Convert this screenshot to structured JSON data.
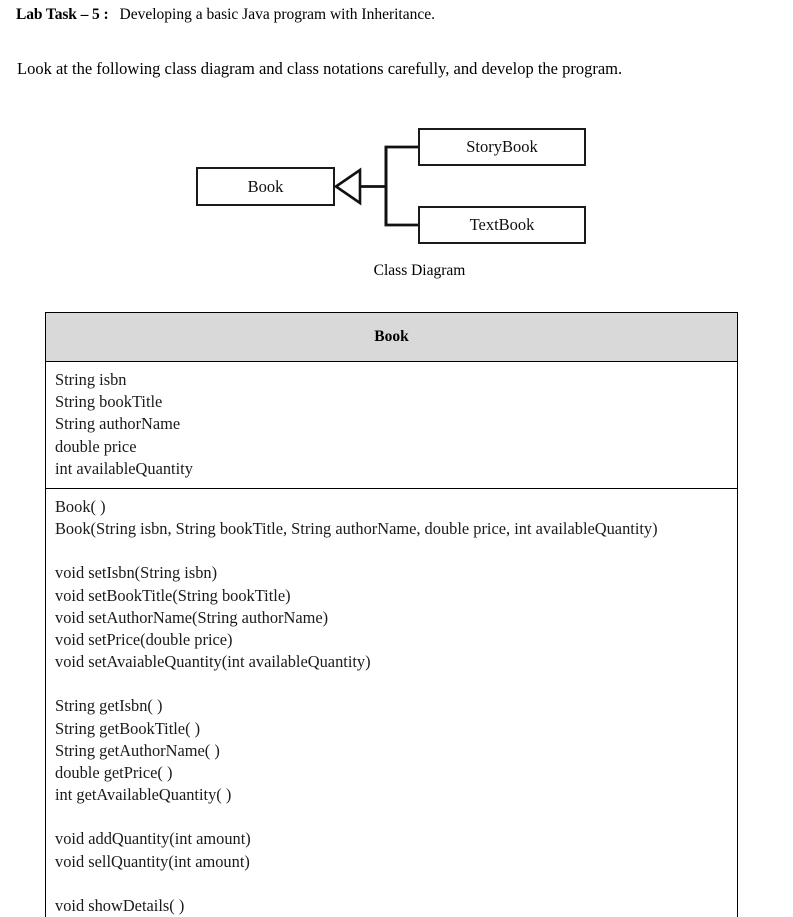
{
  "header": {
    "task_label": "Lab Task – 5 :",
    "task_description": "Developing a basic Java program with Inheritance.",
    "instruction": "Look at the following class diagram and class notations carefully, and develop the program."
  },
  "diagram": {
    "caption": "Class Diagram",
    "relationship": "generalization",
    "parent": {
      "name": "Book"
    },
    "children": [
      {
        "name": "StoryBook"
      },
      {
        "name": "TextBook"
      }
    ],
    "colors": {
      "box_border": "#1a1a1a",
      "box_fill": "#ffffff",
      "connector": "#111111"
    }
  },
  "class_notation": {
    "title": "Book",
    "title_background": "#d9d9d9",
    "border_color": "#000000",
    "attributes": [
      "String isbn",
      "String bookTitle",
      "String authorName",
      "double price",
      "int availableQuantity"
    ],
    "constructors": [
      "Book( )",
      "Book(String isbn, String bookTitle, String authorName, double price, int availableQuantity)"
    ],
    "setters": [
      "void setIsbn(String isbn)",
      "void setBookTitle(String bookTitle)",
      "void setAuthorName(String authorName)",
      "void setPrice(double price)",
      "void setAvaiableQuantity(int availableQuantity)"
    ],
    "getters": [
      "String getIsbn( )",
      "String getBookTitle( )",
      "String getAuthorName( )",
      "double getPrice( )",
      "int getAvailableQuantity( )"
    ],
    "quantity_methods": [
      "void addQuantity(int amount)",
      "void sellQuantity(int amount)"
    ],
    "display_methods": [
      "void showDetails( )"
    ]
  }
}
